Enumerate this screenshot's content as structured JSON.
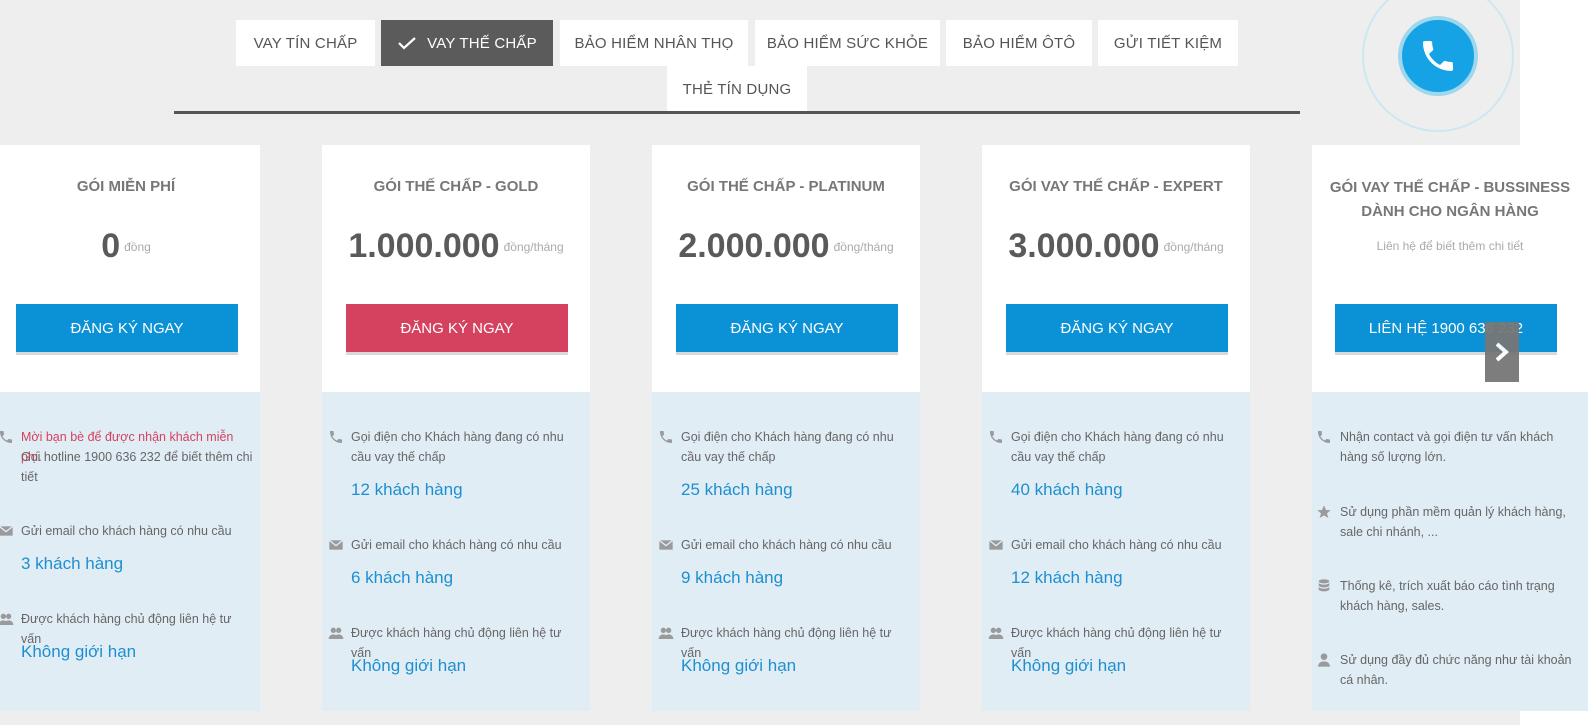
{
  "colors": {
    "accent": "#0b91d5",
    "accent_alt": "#d4425f",
    "tab_active": "#5b5b5b",
    "value_text": "#1e8fd0"
  },
  "tabs": [
    {
      "label": "VAY TÍN CHẤP",
      "active": false
    },
    {
      "label": "VAY THẾ CHẤP",
      "active": true,
      "icon": "check-icon"
    },
    {
      "label": "BẢO HIỂM NHÂN THỌ",
      "active": false
    },
    {
      "label": "BẢO HIỂM SỨC KHỎE",
      "active": false
    },
    {
      "label": "BẢO HIỂM ÔTÔ",
      "active": false
    },
    {
      "label": "GỬI TIẾT KIỆM",
      "active": false
    },
    {
      "label": "THẺ TÍN DỤNG",
      "active": false
    }
  ],
  "plans": [
    {
      "title": "GÓI MIỄN PHÍ",
      "price": "0",
      "unit": "đồng",
      "button": "ĐĂNG KÝ NGAY",
      "features": [
        {
          "icon": "phone-icon",
          "text": "Mời bạn bè để được nhận khách miễn phí.",
          "subtext": "Gọi hotline 1900 636 232 để biết thêm chi tiết"
        },
        {
          "icon": "envelope-icon",
          "text": "Gửi email cho khách hàng có nhu cầu",
          "value": "3 khách hàng"
        },
        {
          "icon": "users-icon",
          "text": "Được khách hàng chủ động liên hệ tư vấn",
          "value": "Không giới hạn"
        }
      ]
    },
    {
      "title": "GÓI THẾ CHẤP - GOLD",
      "price": "1.000.000",
      "unit": "đồng/tháng",
      "button": "ĐĂNG KÝ NGAY",
      "features": [
        {
          "icon": "phone-icon",
          "text": "Gọi điện cho Khách hàng đang có nhu cầu vay thế chấp",
          "value": "12 khách hàng"
        },
        {
          "icon": "envelope-icon",
          "text": "Gửi email cho khách hàng có nhu cầu",
          "value": "6 khách hàng"
        },
        {
          "icon": "users-icon",
          "text": "Được khách hàng chủ động liên hệ tư vấn",
          "value": "Không giới hạn"
        }
      ]
    },
    {
      "title": "GÓI THẾ CHẤP - PLATINUM",
      "price": "2.000.000",
      "unit": "đồng/tháng",
      "button": "ĐĂNG KÝ NGAY",
      "features": [
        {
          "icon": "phone-icon",
          "text": "Gọi điện cho Khách hàng đang có nhu cầu vay thế chấp",
          "value": "25 khách hàng"
        },
        {
          "icon": "envelope-icon",
          "text": "Gửi email cho khách hàng có nhu cầu",
          "value": "9 khách hàng"
        },
        {
          "icon": "users-icon",
          "text": "Được khách hàng chủ động liên hệ tư vấn",
          "value": "Không giới hạn"
        }
      ]
    },
    {
      "title": "GÓI VAY THẾ CHẤP - EXPERT",
      "price": "3.000.000",
      "unit": "đồng/tháng",
      "button": "ĐĂNG KÝ NGAY",
      "features": [
        {
          "icon": "phone-icon",
          "text": "Gọi điện cho Khách hàng đang có nhu cầu vay thế chấp",
          "value": "40 khách hàng"
        },
        {
          "icon": "envelope-icon",
          "text": "Gửi email cho khách hàng có nhu cầu",
          "value": "12 khách hàng"
        },
        {
          "icon": "users-icon",
          "text": "Được khách hàng chủ động liên hệ tư vấn",
          "value": "Không giới hạn"
        }
      ]
    },
    {
      "title_line1": "GÓI VAY THẾ CHẤP - BUSSINESS",
      "title_line2": "DÀNH CHO NGÂN HÀNG",
      "contact_note": "Liên hệ để biết thêm chi tiết",
      "button": "LIÊN HỆ 1900 636 232",
      "features": [
        {
          "icon": "phone-icon",
          "text": "Nhận contact và gọi điện tư vấn khách hàng số lượng lớn."
        },
        {
          "icon": "star-icon",
          "text": "Sử dụng phần mềm quản lý khách hàng, sale chi nhánh, ..."
        },
        {
          "icon": "database-icon",
          "text": "Thống kê, trích xuất báo cáo tình trạng khách hàng, sales."
        },
        {
          "icon": "user-icon",
          "text": "Sử dụng đầy đủ chức năng như tài khoản cá nhân."
        }
      ]
    }
  ],
  "slider": {
    "next_icon": "chevron-right-icon"
  },
  "floating": {
    "call_icon": "phone-call-icon"
  }
}
